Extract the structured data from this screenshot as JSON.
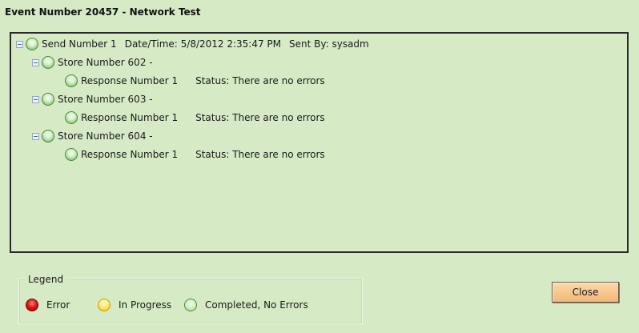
{
  "title": "Event Number 20457 - Network Test",
  "tree": {
    "send": {
      "label": "Send Number 1",
      "datetime": "Date/Time: 5/8/2012 2:35:47 PM",
      "sent_by": "Sent By: sysadm"
    },
    "stores": [
      {
        "label": "Store Number 602 -",
        "response": "Response Number 1",
        "status": "Status: There are no errors"
      },
      {
        "label": "Store Number 603 -",
        "response": "Response Number 1",
        "status": "Status: There are no errors"
      },
      {
        "label": "Store Number 604 -",
        "response": "Response Number 1",
        "status": "Status: There are no errors"
      }
    ]
  },
  "legend": {
    "title": "Legend",
    "items": [
      {
        "label": "Error",
        "color": "red"
      },
      {
        "label": "In Progress",
        "color": "yellow"
      },
      {
        "label": "Completed, No Errors",
        "color": "green"
      }
    ]
  },
  "close_label": "Close"
}
